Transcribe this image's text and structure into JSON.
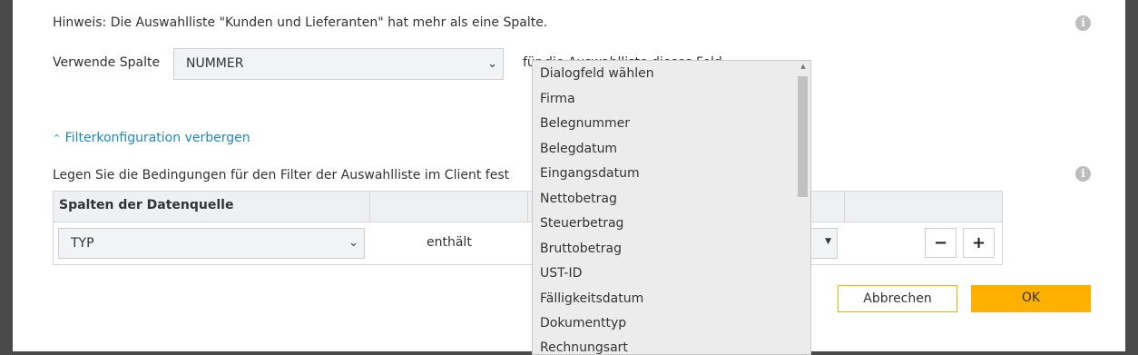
{
  "notice": "Hinweis: Die Auswahlliste \"Kunden und Lieferanten\" hat mehr als eine Spalte.",
  "column_setting": {
    "label": "Verwende Spalte",
    "value": "NUMMER",
    "suffix": "für die Auswahlliste dieses Feld..."
  },
  "filter_toggle": "Filterkonfiguration verbergen",
  "filter_description": "Legen Sie die Bedingungen für den Filter der Auswahlliste im Client fest",
  "table": {
    "header": "Spalten der Datenquelle",
    "row": {
      "column": "TYP",
      "operator": "enthält"
    }
  },
  "buttons": {
    "minus": "−",
    "plus": "+",
    "cancel": "Abbrechen",
    "ok": "OK"
  },
  "dropdown_items": [
    "Dialogfeld wählen",
    "Firma",
    "Belegnummer",
    "Belegdatum",
    "Eingangsdatum",
    "Nettobetrag",
    "Steuerbetrag",
    "Bruttobetrag",
    "UST-ID",
    "Fälligkeitsdatum",
    "Dokumenttyp",
    "Rechnungsart"
  ],
  "colors": {
    "accent": "#ffb000",
    "link": "#1f8ac0",
    "cancel_border": "#e2b600"
  },
  "icons": [
    "info-icon",
    "chevron-down-icon",
    "chevron-up-icon",
    "scroll-up-arrow-icon"
  ]
}
